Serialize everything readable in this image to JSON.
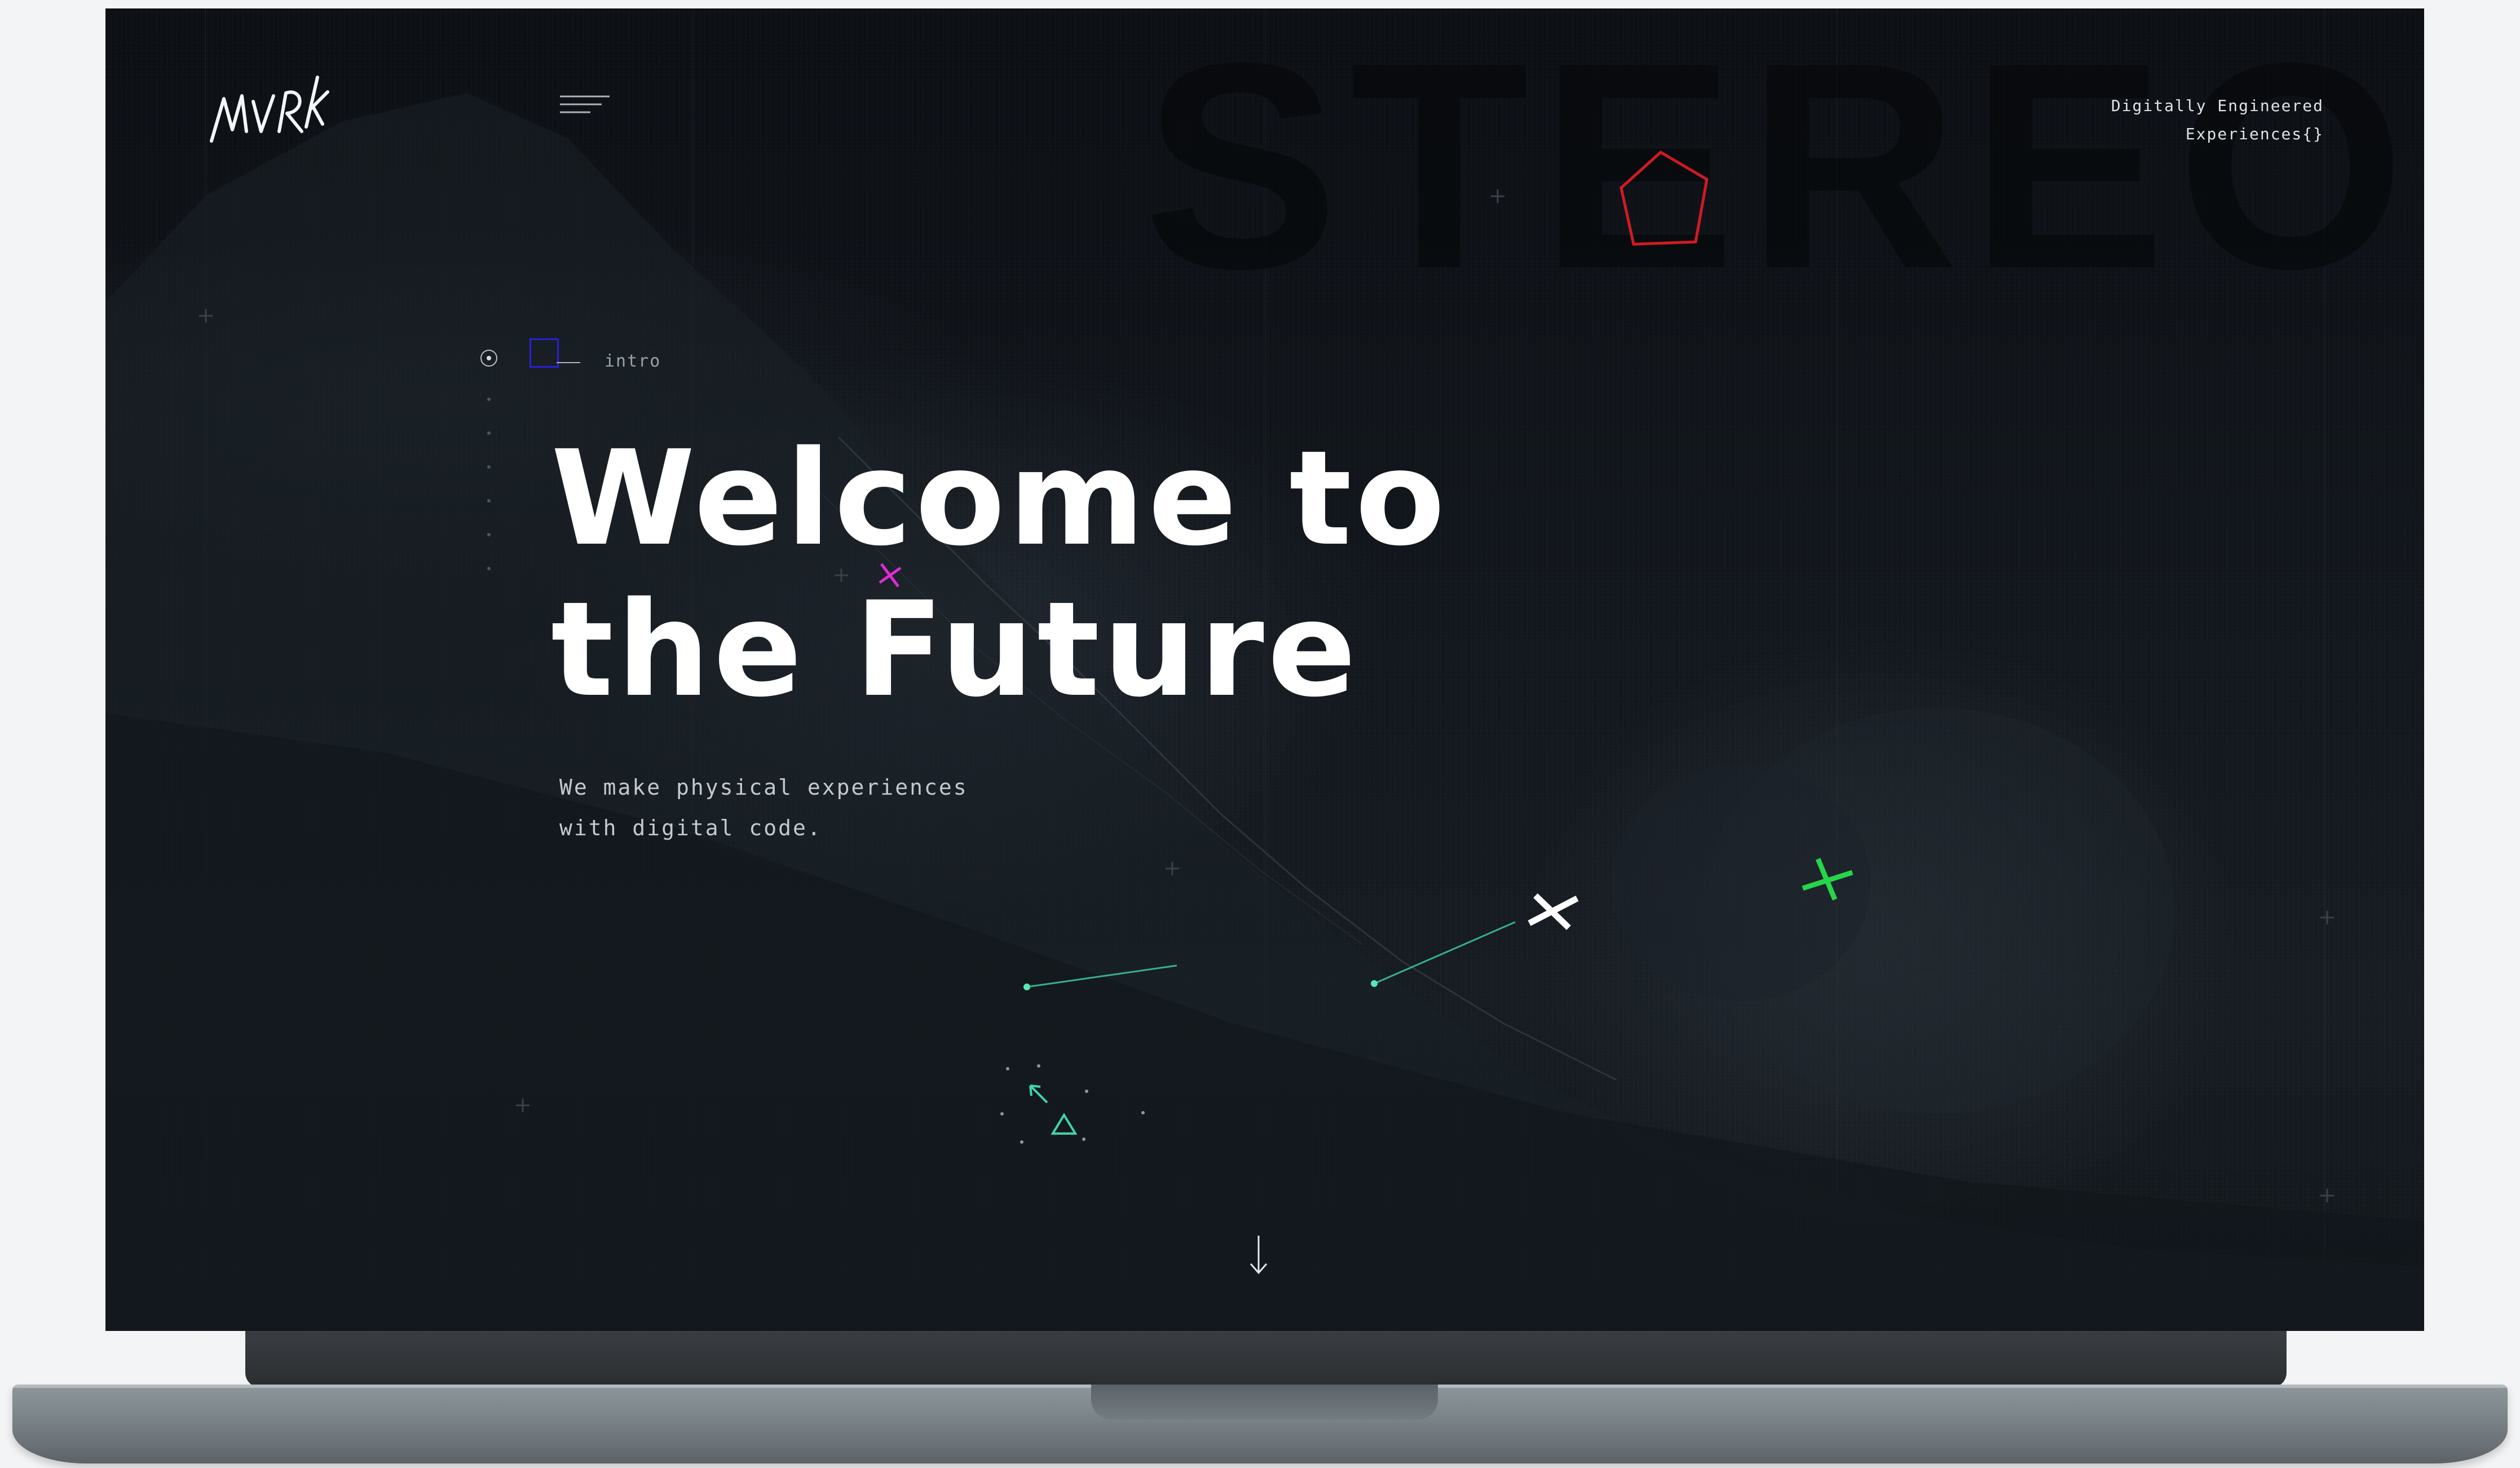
{
  "brand": {
    "logo_text": "MVRK",
    "tagline_line1": "Digitally Engineered",
    "tagline_line2": "Experiences{}"
  },
  "background": {
    "word": "STEREO"
  },
  "section_nav": {
    "active_label": "intro",
    "dot_count": 6
  },
  "hero": {
    "title_line1": "Welcome to",
    "title_line2": "the Future",
    "subtitle_line1": "We make physical experiences",
    "subtitle_line2": "with digital code."
  },
  "icons": {
    "menu": "hamburger-menu-icon",
    "scroll": "arrow-down-icon"
  },
  "colors": {
    "screen_bg": "#12171d",
    "text_primary": "#ffffff",
    "text_secondary": "#c4c9ce",
    "accent_red": "#d11a22",
    "accent_blue": "#2a1fd6",
    "accent_magenta": "#e22ad8",
    "accent_green": "#26d64a",
    "accent_teal": "#3fd6a8"
  }
}
